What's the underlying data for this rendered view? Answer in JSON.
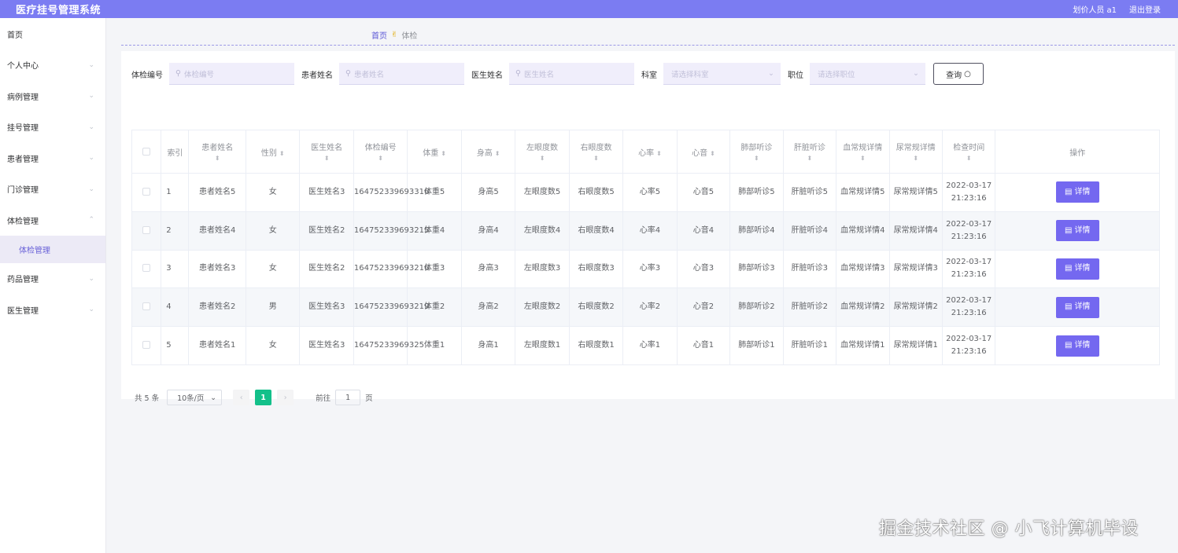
{
  "app": {
    "title": "医疗挂号管理系统",
    "user_label": "划价人员 a1",
    "logout_label": "退出登录"
  },
  "sidebar": {
    "items": [
      {
        "label": "首页",
        "has_arrow": false
      },
      {
        "label": "个人中心",
        "has_arrow": true
      },
      {
        "label": "病例管理",
        "has_arrow": true
      },
      {
        "label": "挂号管理",
        "has_arrow": true
      },
      {
        "label": "患者管理",
        "has_arrow": true
      },
      {
        "label": "门诊管理",
        "has_arrow": true
      },
      {
        "label": "体检管理",
        "has_arrow": true,
        "expanded": true
      },
      {
        "label": "药品管理",
        "has_arrow": true
      },
      {
        "label": "医生管理",
        "has_arrow": true
      }
    ],
    "active_sub": "体检管理"
  },
  "breadcrumb": {
    "home": "首页",
    "current": "体检"
  },
  "search": {
    "exam_no_label": "体检编号",
    "exam_no_placeholder": "体检编号",
    "patient_label": "患者姓名",
    "patient_placeholder": "患者姓名",
    "doctor_label": "医生姓名",
    "doctor_placeholder": "医生姓名",
    "dept_label": "科室",
    "dept_placeholder": "请选择科室",
    "position_label": "职位",
    "position_placeholder": "请选择职位",
    "query_label": "查询"
  },
  "table": {
    "headers": {
      "index": "索引",
      "patient": "患者姓名",
      "gender": "性别",
      "doctor": "医生姓名",
      "exam_no": "体检编号",
      "weight": "体重",
      "height": "身高",
      "left_eye": "左眼度数",
      "right_eye": "右眼度数",
      "heart_rate": "心率",
      "heart_sound": "心音",
      "lung": "肺部听诊",
      "liver": "肝脏听诊",
      "blood": "血常规详情",
      "urine": "尿常规详情",
      "exam_time": "检查时间",
      "action": "操作"
    },
    "detail_label": "详情",
    "rows": [
      {
        "index": "1",
        "patient": "患者姓名5",
        "gender": "女",
        "doctor": "医生姓名3",
        "exam_no": "164752339693316",
        "weight": "体重5",
        "height": "身高5",
        "left_eye": "左眼度数5",
        "right_eye": "右眼度数5",
        "heart_rate": "心率5",
        "heart_sound": "心音5",
        "lung": "肺部听诊5",
        "liver": "肝脏听诊5",
        "blood": "血常规详情5",
        "urine": "尿常规详情5",
        "exam_time": "2022-03-17 21:23:16"
      },
      {
        "index": "2",
        "patient": "患者姓名4",
        "gender": "女",
        "doctor": "医生姓名2",
        "exam_no": "164752339693215",
        "weight": "体重4",
        "height": "身高4",
        "left_eye": "左眼度数4",
        "right_eye": "右眼度数4",
        "heart_rate": "心率4",
        "heart_sound": "心音4",
        "lung": "肺部听诊4",
        "liver": "肝脏听诊4",
        "blood": "血常规详情4",
        "urine": "尿常规详情4",
        "exam_time": "2022-03-17 21:23:16"
      },
      {
        "index": "3",
        "patient": "患者姓名3",
        "gender": "女",
        "doctor": "医生姓名2",
        "exam_no": "164752339693216",
        "weight": "体重3",
        "height": "身高3",
        "left_eye": "左眼度数3",
        "right_eye": "右眼度数3",
        "heart_rate": "心率3",
        "heart_sound": "心音3",
        "lung": "肺部听诊3",
        "liver": "肝脏听诊3",
        "blood": "血常规详情3",
        "urine": "尿常规详情3",
        "exam_time": "2022-03-17 21:23:16"
      },
      {
        "index": "4",
        "patient": "患者姓名2",
        "gender": "男",
        "doctor": "医生姓名3",
        "exam_no": "164752339693219",
        "weight": "体重2",
        "height": "身高2",
        "left_eye": "左眼度数2",
        "right_eye": "右眼度数2",
        "heart_rate": "心率2",
        "heart_sound": "心音2",
        "lung": "肺部听诊2",
        "liver": "肝脏听诊2",
        "blood": "血常规详情2",
        "urine": "尿常规详情2",
        "exam_time": "2022-03-17 21:23:16"
      },
      {
        "index": "5",
        "patient": "患者姓名1",
        "gender": "女",
        "doctor": "医生姓名3",
        "exam_no": "16475233969325",
        "weight": "体重1",
        "height": "身高1",
        "left_eye": "左眼度数1",
        "right_eye": "右眼度数1",
        "heart_rate": "心率1",
        "heart_sound": "心音1",
        "lung": "肺部听诊1",
        "liver": "肝脏听诊1",
        "blood": "血常规详情1",
        "urine": "尿常规详情1",
        "exam_time": "2022-03-17 21:23:16"
      }
    ]
  },
  "pagination": {
    "total_label": "共 5 条",
    "page_size_label": "10条/页",
    "current_page": "1",
    "goto_label": "前往",
    "goto_value": "1",
    "page_suffix": "页"
  },
  "watermark": "掘金技术社区 @ 小飞计算机毕设",
  "colors": {
    "topbar": "#7b7cf2",
    "accent": "#7468f0",
    "page_active": "#13c08a"
  }
}
